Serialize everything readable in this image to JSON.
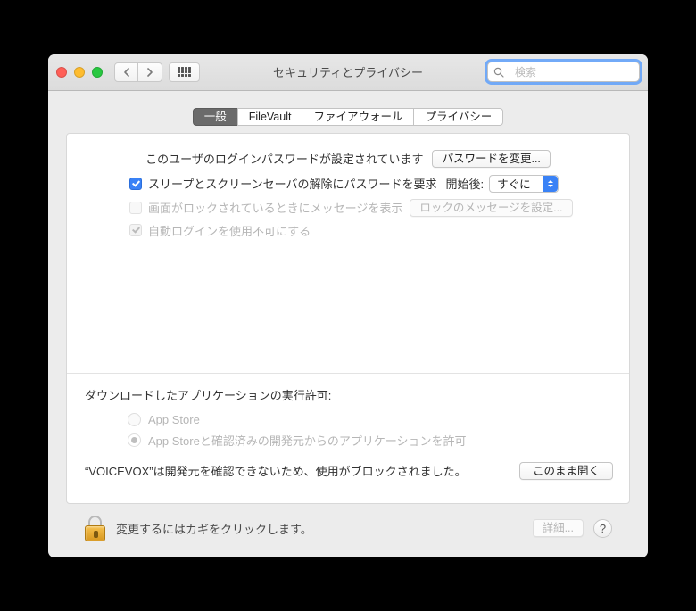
{
  "window": {
    "title": "セキュリティとプライバシー"
  },
  "search": {
    "placeholder": "検索"
  },
  "tabs": [
    {
      "label": "一般",
      "selected": true
    },
    {
      "label": "FileVault",
      "selected": false
    },
    {
      "label": "ファイアウォール",
      "selected": false
    },
    {
      "label": "プライバシー",
      "selected": false
    }
  ],
  "login": {
    "status": "このユーザのログインパスワードが設定されています",
    "change_button": "パスワードを変更...",
    "require_password_label": "スリープとスクリーンセーバの解除にパスワードを要求",
    "delay_label": "開始後:",
    "delay_value": "すぐに",
    "lock_message_label": "画面がロックされているときにメッセージを表示",
    "lock_message_button": "ロックのメッセージを設定...",
    "disable_autologin_label": "自動ログインを使用不可にする"
  },
  "download": {
    "title": "ダウンロードしたアプリケーションの実行許可:",
    "opt_appstore": "App Store",
    "opt_identified": "App Storeと確認済みの開発元からのアプリケーションを許可",
    "blocked_message": "“VOICEVOX”は開発元を確認できないため、使用がブロックされました。",
    "open_anyway": "このまま開く"
  },
  "footer": {
    "unlock_hint": "変更するにはカギをクリックします。",
    "advanced": "詳細..."
  }
}
